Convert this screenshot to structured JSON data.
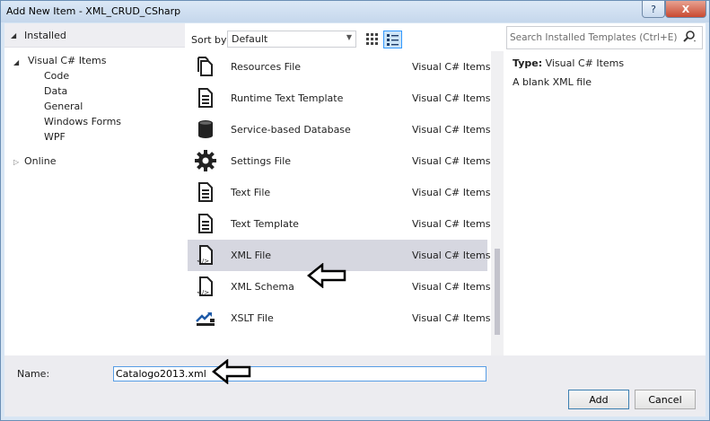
{
  "window": {
    "title": "Add New Item - XML_CRUD_CSharp",
    "help_label": "?",
    "close_label": "X"
  },
  "tree": {
    "installed": "Installed",
    "visual_csharp": "Visual C# Items",
    "children": [
      "Code",
      "Data",
      "General",
      "Windows Forms",
      "WPF"
    ],
    "online": "Online"
  },
  "toolbar": {
    "sort_label": "Sort by:",
    "sort_value": "Default"
  },
  "templates": [
    {
      "name": "Resources File",
      "category": "Visual C# Items",
      "icon": "resources-file-icon"
    },
    {
      "name": "Runtime Text Template",
      "category": "Visual C# Items",
      "icon": "text-template-icon"
    },
    {
      "name": "Service-based Database",
      "category": "Visual C# Items",
      "icon": "database-icon"
    },
    {
      "name": "Settings File",
      "category": "Visual C# Items",
      "icon": "gear-icon"
    },
    {
      "name": "Text File",
      "category": "Visual C# Items",
      "icon": "text-file-icon"
    },
    {
      "name": "Text Template",
      "category": "Visual C# Items",
      "icon": "text-template-icon"
    },
    {
      "name": "XML File",
      "category": "Visual C# Items",
      "icon": "xml-file-icon",
      "selected": true
    },
    {
      "name": "XML Schema",
      "category": "Visual C# Items",
      "icon": "xml-schema-icon"
    },
    {
      "name": "XSLT File",
      "category": "Visual C# Items",
      "icon": "xslt-file-icon"
    }
  ],
  "search": {
    "placeholder": "Search Installed Templates (Ctrl+E)"
  },
  "details": {
    "type_label": "Type:",
    "type_value": "Visual C# Items",
    "description": "A blank XML file"
  },
  "name_field": {
    "label": "Name:",
    "value": "Catalogo2013.xml"
  },
  "buttons": {
    "add": "Add",
    "cancel": "Cancel"
  }
}
